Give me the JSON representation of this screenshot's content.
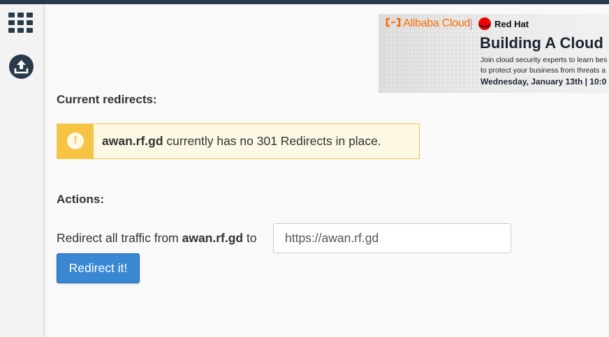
{
  "sidebar": {
    "icons": [
      "apps-grid-icon",
      "upload-icon"
    ]
  },
  "ad": {
    "alibaba_brand": "Alibaba Cloud",
    "redhat_brand": "Red Hat",
    "title": "Building A Cloud",
    "line1": "Join cloud security experts to learn bes",
    "line2": "to protect your business from threats a",
    "date": "Wednesday, January 13th | 10:0"
  },
  "current_redirects": {
    "heading": "Current redirects:",
    "alert_domain": "awan.rf.gd",
    "alert_text": " currently has no 301 Redirects in place.",
    "alert_icon": "exclamation-icon",
    "alert_color": "#f6c342"
  },
  "actions": {
    "heading": "Actions:",
    "redirect_prefix": "Redirect all traffic from ",
    "redirect_domain": "awan.rf.gd",
    "redirect_suffix": " to",
    "url_value": "https://awan.rf.gd",
    "button_label": "Redirect it!",
    "button_color": "#3a87d4"
  }
}
